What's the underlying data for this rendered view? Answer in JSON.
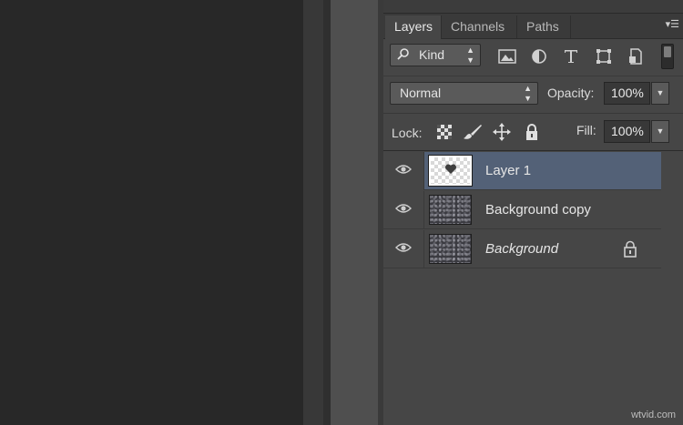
{
  "layers_panel": {
    "tabs": [
      {
        "label": "Layers",
        "active": true
      },
      {
        "label": "Channels",
        "active": false
      },
      {
        "label": "Paths",
        "active": false
      }
    ],
    "filter": {
      "kind_label": "Kind",
      "icons": [
        "image-filter-icon",
        "adjustment-filter-icon",
        "type-filter-icon",
        "shape-filter-icon",
        "smart-object-filter-icon"
      ]
    },
    "blend_mode": "Normal",
    "opacity_label": "Opacity:",
    "opacity_value": "100%",
    "lock_label": "Lock:",
    "lock_icons": [
      "lock-transparent-pixels-icon",
      "lock-image-pixels-icon",
      "lock-position-icon",
      "lock-all-icon"
    ],
    "fill_label": "Fill:",
    "fill_value": "100%",
    "layers": [
      {
        "name": "Layer 1",
        "visible": true,
        "selected": true,
        "italic": false,
        "locked": false
      },
      {
        "name": "Background copy",
        "visible": true,
        "selected": false,
        "italic": false,
        "locked": false
      },
      {
        "name": "Background",
        "visible": true,
        "selected": false,
        "italic": true,
        "locked": true
      }
    ]
  },
  "colors": {
    "panel_bg": "#464646",
    "selection": "#536177",
    "canvas_bg": "#282828"
  },
  "watermark": "wtvid.com"
}
